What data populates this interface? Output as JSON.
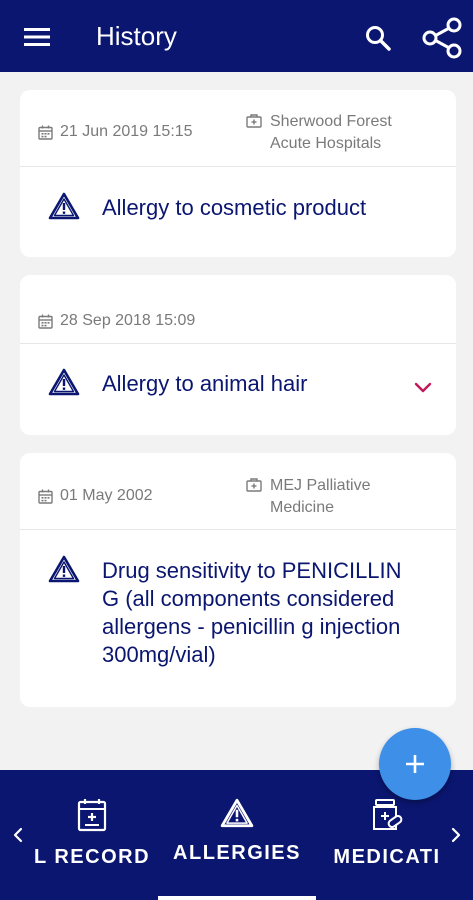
{
  "header": {
    "title": "History",
    "menu_icon": "menu-icon",
    "search_icon": "search-icon",
    "share_icon": "share-icon"
  },
  "records": [
    {
      "date": "21 Jun 2019 15:15",
      "location_line1": "Sherwood Forest",
      "location_line2": "Acute Hospitals",
      "title": "Allergy to cosmetic product"
    },
    {
      "date": "28 Sep 2018 15:09",
      "title": "Allergy to animal hair"
    },
    {
      "date": "01 May 2002",
      "location_line1": "MEJ Palliative",
      "location_line2": "Medicine",
      "title_lines": [
        "Drug sensitivity to PENICILLIN",
        "G (all components considered",
        "allergens - penicillin g injection",
        "300mg/vial)"
      ]
    }
  ],
  "fab": {
    "label": "+"
  },
  "bottom_nav": {
    "tabs": [
      {
        "label": "L RECORD",
        "icon": "medical-record-icon"
      },
      {
        "label": "ALLERGIES",
        "icon": "warning-triangle-icon"
      },
      {
        "label": "MEDICATI",
        "icon": "medication-icon"
      }
    ],
    "prev_icon": "chevron-left-icon",
    "next_icon": "chevron-right-icon"
  },
  "colors": {
    "primary": "#0b1670",
    "accent": "#3d8fe8",
    "chevron": "#c2185b",
    "background": "#f2f2f2"
  }
}
